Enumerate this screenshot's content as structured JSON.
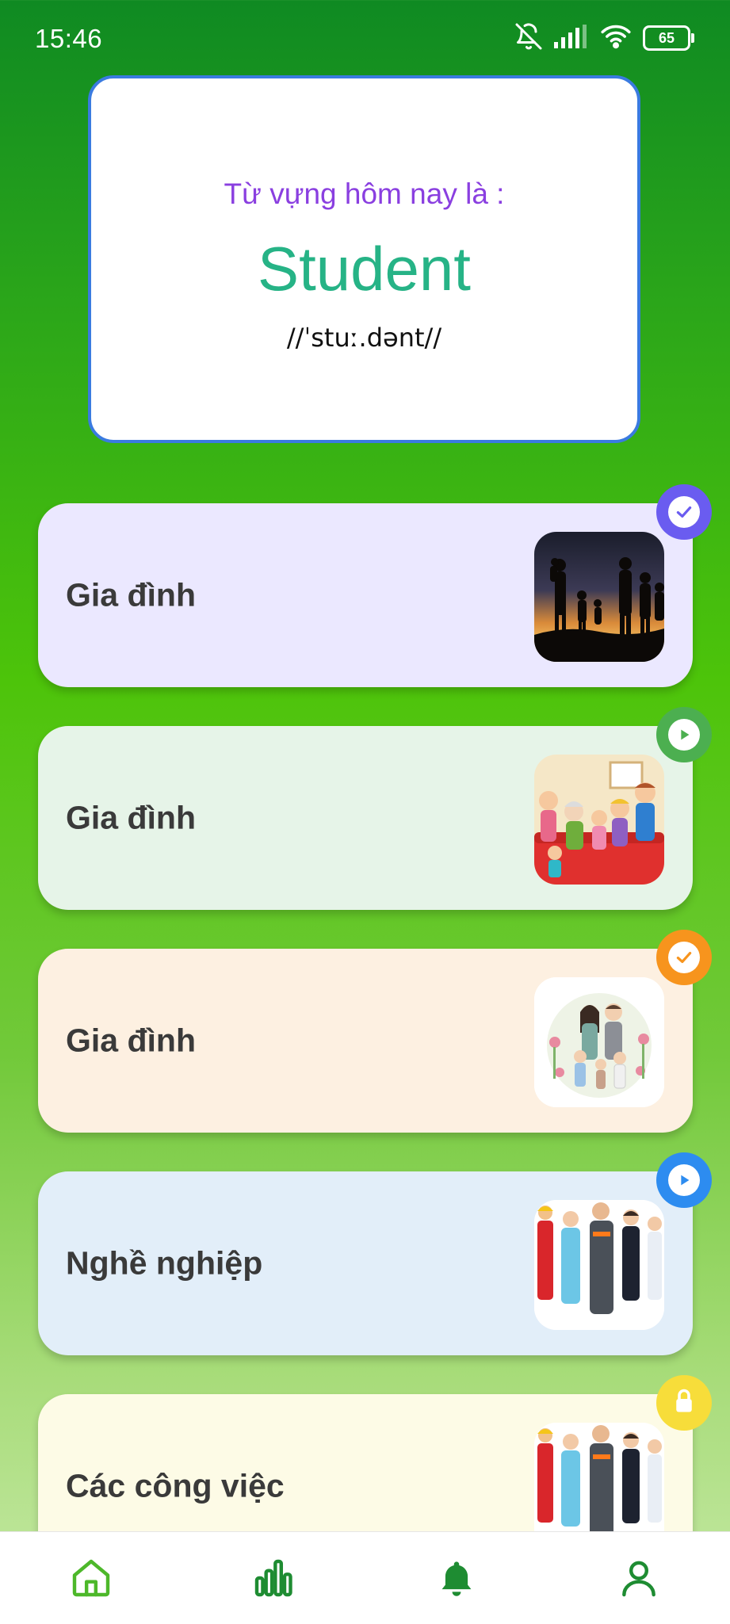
{
  "status_bar": {
    "time": "15:46",
    "battery": "65",
    "icons": [
      "bell-off-icon",
      "signal-icon",
      "wifi-icon",
      "battery-icon"
    ]
  },
  "word_of_day": {
    "intro": "Từ vựng hôm nay là :",
    "word": "Student",
    "pronunciation": "//ˈstuː.dənt//"
  },
  "topics": [
    {
      "title": "Gia đình",
      "status": "completed",
      "badge_icon": "check-icon",
      "badge_color": "#6a5cf0",
      "bg": "#ebe8ff",
      "thumb": "family-silhouette-image"
    },
    {
      "title": "Gia đình",
      "status": "play",
      "badge_icon": "play-icon",
      "badge_color": "#4caf50",
      "bg": "#e6f4e8",
      "thumb": "family-cartoon-image"
    },
    {
      "title": "Gia đình",
      "status": "completed",
      "badge_icon": "check-icon",
      "badge_color": "#f7941d",
      "bg": "#fdf0e1",
      "thumb": "family-illustration-image"
    },
    {
      "title": "Nghề nghiệp",
      "status": "play",
      "badge_icon": "play-icon",
      "badge_color": "#2d8cf0",
      "bg": "#e2eef9",
      "thumb": "occupations-image"
    },
    {
      "title": "Các công việc",
      "status": "locked",
      "badge_icon": "lock-icon",
      "badge_color": "#f7dd3a",
      "bg": "#fdfbe6",
      "thumb": "jobs-image"
    }
  ],
  "bottom_nav": [
    {
      "name": "home",
      "icon": "home-icon",
      "active": true
    },
    {
      "name": "stats",
      "icon": "bar-chart-icon",
      "active": false
    },
    {
      "name": "notifications",
      "icon": "bell-icon",
      "active": false
    },
    {
      "name": "profile",
      "icon": "user-icon",
      "active": false
    }
  ],
  "colors": {
    "accent_green": "#1e8c32",
    "card_border": "#3a7be0",
    "intro_purple": "#8a3fe0",
    "word_green": "#26b386"
  }
}
